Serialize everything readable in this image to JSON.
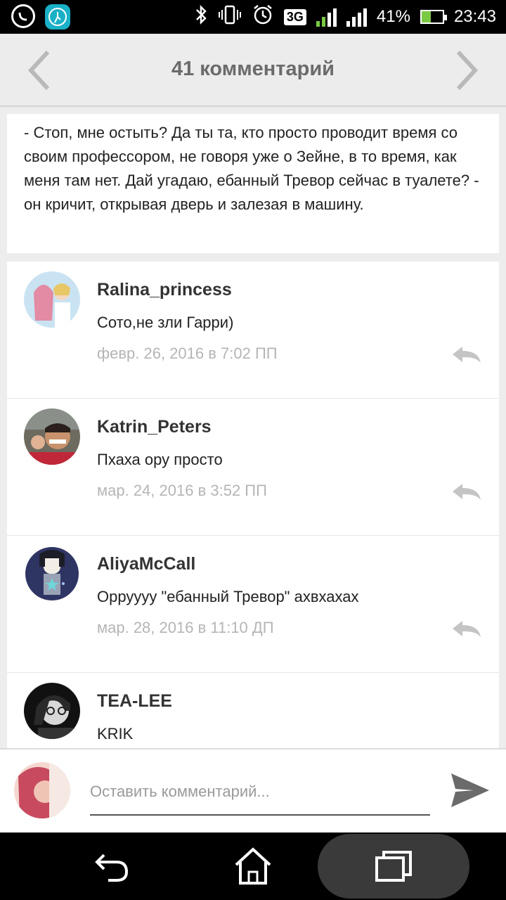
{
  "status_bar": {
    "network": "3G",
    "sim1": "1",
    "sim2": "2",
    "battery": "41%",
    "time": "23:43"
  },
  "header": {
    "title": "41 комментарий"
  },
  "post": {
    "text": "- Стоп, мне остыть? Да ты та, кто просто проводит время со своим профессором, не говоря уже о Зейне, в то время, как меня там нет. Дай угадаю, ебанный Тревор сейчас в туалете? - он кричит, открывая дверь и залезая в машину."
  },
  "comments": [
    {
      "user": "Ralina_princess",
      "text": "Сото,не зли Гарри)",
      "date": "февр. 26, 2016 в 7:02 ПП"
    },
    {
      "user": "Katrin_Peters",
      "text": "Пхаха ору просто",
      "date": "мар. 24, 2016 в 3:52 ПП"
    },
    {
      "user": "AliyaMcCall",
      "text": "Орруууу \"ебанный Тревор\" ахвхахах",
      "date": "мар. 28, 2016 в 11:10 ДП"
    },
    {
      "user": "TEA-LEE",
      "text": "KRIK",
      "date": ""
    }
  ],
  "composer": {
    "placeholder": "Оставить комментарий..."
  },
  "colors": {
    "header_bg": "#ececec",
    "title": "#6b6b6b",
    "date": "#b5b5b5",
    "fitness_icon": "#1ab0c8",
    "signal_green": "#7ac943"
  },
  "icons": {
    "nav_prev": "chevron-left-icon",
    "nav_next": "chevron-right-icon",
    "reply": "reply-icon",
    "send": "send-icon",
    "back": "back-icon",
    "home": "home-icon",
    "recents": "recents-icon"
  }
}
